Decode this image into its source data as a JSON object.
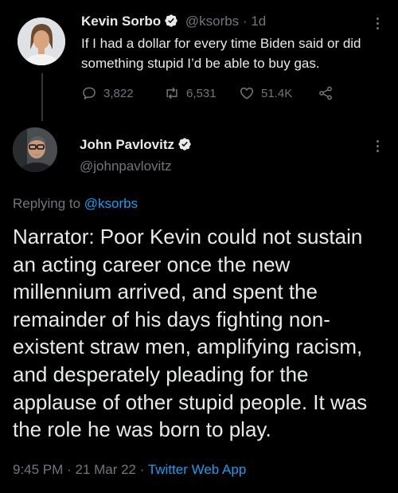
{
  "tweet1": {
    "name": "Kevin Sorbo",
    "handle": "@ksorbs",
    "separator": "·",
    "time": "1d",
    "text": "If I had a dollar for every time Biden said or did something stupid I’d be able to buy gas.",
    "replies": "3,822",
    "retweets": "6,531",
    "likes": "51.4K",
    "icons": [
      "reply-icon",
      "retweet-icon",
      "like-icon",
      "share-icon"
    ]
  },
  "tweet2": {
    "name": "John Pavlovitz",
    "handle": "@johnpavlovitz",
    "replying_prefix": "Replying to",
    "replying_handle": "@ksorbs",
    "text": "Narrator: Poor Kevin could not sustain an acting career once the new millennium arrived, and spent the remainder of his days fighting non-existent straw men, amplifying racism, and desperately pleading for the applause of other stupid people. It was the role he was born to play.",
    "time": "9:45 PM",
    "date": "21 Mar 22",
    "separator": "·",
    "app": "Twitter Web App"
  },
  "colors": {
    "background": "#000000",
    "text": "#e7e9ea",
    "muted": "#71767b",
    "link": "#1d9bf0",
    "verified": "#e7e9ea"
  }
}
